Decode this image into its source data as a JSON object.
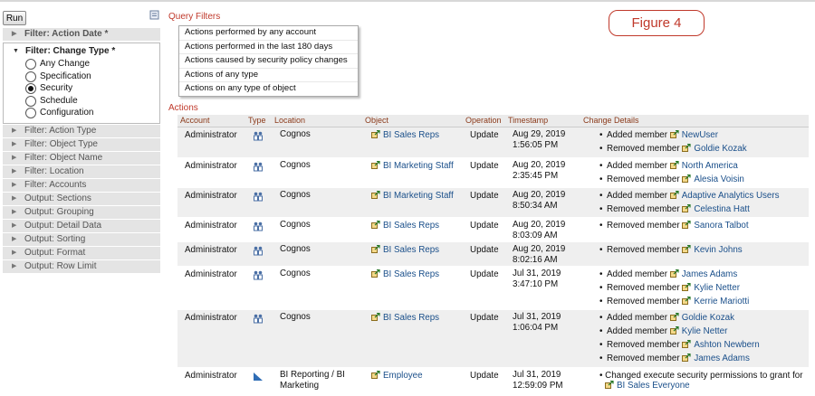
{
  "run_label": "Run",
  "left_panel": {
    "top_filter": "Filter: Action Date *",
    "expanded": {
      "title": "Filter: Change Type *",
      "options": [
        {
          "label": "Any Change",
          "selected": false
        },
        {
          "label": "Specification",
          "selected": false
        },
        {
          "label": "Security",
          "selected": true
        },
        {
          "label": "Schedule",
          "selected": false
        },
        {
          "label": "Configuration",
          "selected": false
        }
      ]
    },
    "sections": [
      "Filter: Action Type",
      "Filter: Object Type",
      "Filter: Object Name",
      "Filter: Location",
      "Filter: Accounts",
      "Output: Sections",
      "Output: Grouping",
      "Output: Detail Data",
      "Output: Sorting",
      "Output: Format",
      "Output: Row Limit"
    ]
  },
  "query_filters": {
    "title": "Query Filters",
    "items": [
      "Actions performed by any account",
      "Actions performed in the last 180 days",
      "Actions caused by security policy changes",
      "Actions of any type",
      "Actions on any type of object"
    ]
  },
  "figure_label": "Figure 4",
  "actions": {
    "title": "Actions",
    "columns": [
      "Account",
      "Type",
      "Location",
      "Object",
      "Operation",
      "Timestamp",
      "Change Details"
    ],
    "rows": [
      {
        "account": "Administrator",
        "location": "Cognos",
        "object": "BI Sales Reps",
        "operation": "Update",
        "ts_date": "Aug 29, 2019",
        "ts_time": "1:56:05 PM",
        "height": 33,
        "details": [
          {
            "action": "Added member",
            "who": "NewUser"
          },
          {
            "action": "Removed member",
            "who": "Goldie Kozak"
          }
        ]
      },
      {
        "account": "Administrator",
        "location": "Cognos",
        "object": "BI Marketing Staff",
        "operation": "Update",
        "ts_date": "Aug 20, 2019",
        "ts_time": "2:35:45 PM",
        "height": 32,
        "details": [
          {
            "action": "Added member",
            "who": "North America"
          },
          {
            "action": "Removed member",
            "who": "Alesia Voisin"
          }
        ]
      },
      {
        "account": "Administrator",
        "location": "Cognos",
        "object": "BI Marketing Staff",
        "operation": "Update",
        "ts_date": "Aug 20, 2019",
        "ts_time": "8:50:34 AM",
        "height": 32,
        "details": [
          {
            "action": "Added member",
            "who": "Adaptive Analytics Users"
          },
          {
            "action": "Removed member",
            "who": "Celestina Hatt"
          }
        ]
      },
      {
        "account": "Administrator",
        "location": "Cognos",
        "object": "BI Sales Reps",
        "operation": "Update",
        "ts_date": "Aug 20, 2019",
        "ts_time": "8:03:09 AM",
        "height": 26,
        "details": [
          {
            "action": "Removed member",
            "who": "Sanora Talbot"
          }
        ]
      },
      {
        "account": "Administrator",
        "location": "Cognos",
        "object": "BI Sales Reps",
        "operation": "Update",
        "ts_date": "Aug 20, 2019",
        "ts_time": "8:02:16 AM",
        "height": 26,
        "details": [
          {
            "action": "Removed member",
            "who": "Kevin Johns"
          }
        ]
      },
      {
        "account": "Administrator",
        "location": "Cognos",
        "object": "BI Sales Reps",
        "operation": "Update",
        "ts_date": "Jul 31, 2019",
        "ts_time": "3:47:10 PM",
        "height": 47,
        "details": [
          {
            "action": "Added member",
            "who": "James Adams"
          },
          {
            "action": "Removed member",
            "who": "Kylie Netter"
          },
          {
            "action": "Removed member",
            "who": "Kerrie Mariotti"
          }
        ]
      },
      {
        "account": "Administrator",
        "location": "Cognos",
        "object": "BI Sales Reps",
        "operation": "Update",
        "ts_date": "Jul 31, 2019",
        "ts_time": "1:06:04 PM",
        "height": 63,
        "details": [
          {
            "action": "Added member",
            "who": "Goldie Kozak"
          },
          {
            "action": "Added member",
            "who": "Kylie Netter"
          },
          {
            "action": "Removed member",
            "who": "Ashton Newbern"
          },
          {
            "action": "Removed member",
            "who": "James Adams"
          }
        ]
      },
      {
        "account": "Administrator",
        "location": "BI Reporting / BI Marketing",
        "object": "Employee",
        "operation": "Update",
        "ts_date": "Jul 31, 2019",
        "ts_time": "12:59:09 PM",
        "height": 30,
        "kind": "report",
        "details_wrap": {
          "text": "Changed execute security permissions to grant for",
          "who": "BI Sales Everyone"
        }
      }
    ]
  },
  "colors": {
    "accent": "#c0392b",
    "link": "#1a4f8a",
    "header_text": "#8b3a1a",
    "row_alt": "#efefef"
  },
  "icons": {
    "group": "group-icon",
    "object": "object-link-icon",
    "report": "report-icon",
    "query": "query-filter-icon"
  }
}
